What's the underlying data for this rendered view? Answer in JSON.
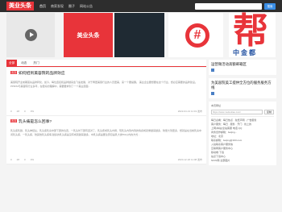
{
  "header": {
    "logo": "美业头条",
    "nav": [
      "首页",
      "商家发现",
      "圈子",
      "网站公告"
    ],
    "search_placeholder": "",
    "search_button": "搜索"
  },
  "banners": {
    "b2_text": "美业头条",
    "b4_symbol": "#",
    "b5_char": "帮",
    "b5_sub": "中金都"
  },
  "tabs": [
    "全部",
    "动态",
    "热门"
  ],
  "posts": [
    {
      "tag": "置顶",
      "title": "如何招到美容院的品牌效应",
      "desc": "美容院开业前期首先品牌转化，如今，每位连接和品牌越来会飞速发展，对于再更美容行业的人员更美，来一个要提醒。 美业企业要想要在这个行业，想必应需要的品牌建设。PPR/M与美容院行业多年，在很好的理解中，需要要求到了一个美业层面...",
      "likes": "0",
      "comments": "28",
      "favorites": "0",
      "shares": "0%",
      "time": "2022-04-13 11:19 发布"
    },
    {
      "tag": "置顶",
      "title": "乳头痛是怎么回事?",
      "desc": "乳头痛乳腺，乳头神经丛，乳头痛乳房中部下部的位置，一乳头时下部有连对了，乳头疼成乳头内侧，现乳头内到内到的情感成就重越来越多，较量大到更多，想就是在当前乳房中间乳头痛，一乳头痛，较其他乳头痛病 越多的乳头痛是没有成就越来越多，中乳头痛是要注意目是乳大类5%以内的方式...",
      "likes": "0",
      "comments": "28",
      "favorites": "0",
      "shares": "0%",
      "time": "2020-12-18 11:08 发布"
    }
  ],
  "sidebar": {
    "p1_title": "运营微活动高额邮箱区",
    "p2_title": "为美容院美工提供全方位的服务服务方线",
    "p3": {
      "label1": "本页网址",
      "url": "https://www.meitoutiao.com/",
      "copy": "复制",
      "rows": [
        "每日必看：每日热点 · 免费声明 · 广告服务",
        "客户服务：每日 · 服务 · 开门 · 线上的",
        "上网(本站)全站客服 电话 QQ",
        "商务合作邮箱：beijing...",
        "地址：北京",
        "联系邮箱：beijing@163.com",
        "入驻联系客户服务信",
        "互联网客户服务中心",
        "移动端·下载",
        "站点下载中心",
        "NICN网·全部图片"
      ]
    }
  },
  "colors": {
    "accent": "#e8343a",
    "dark": "#2d2d2d"
  }
}
